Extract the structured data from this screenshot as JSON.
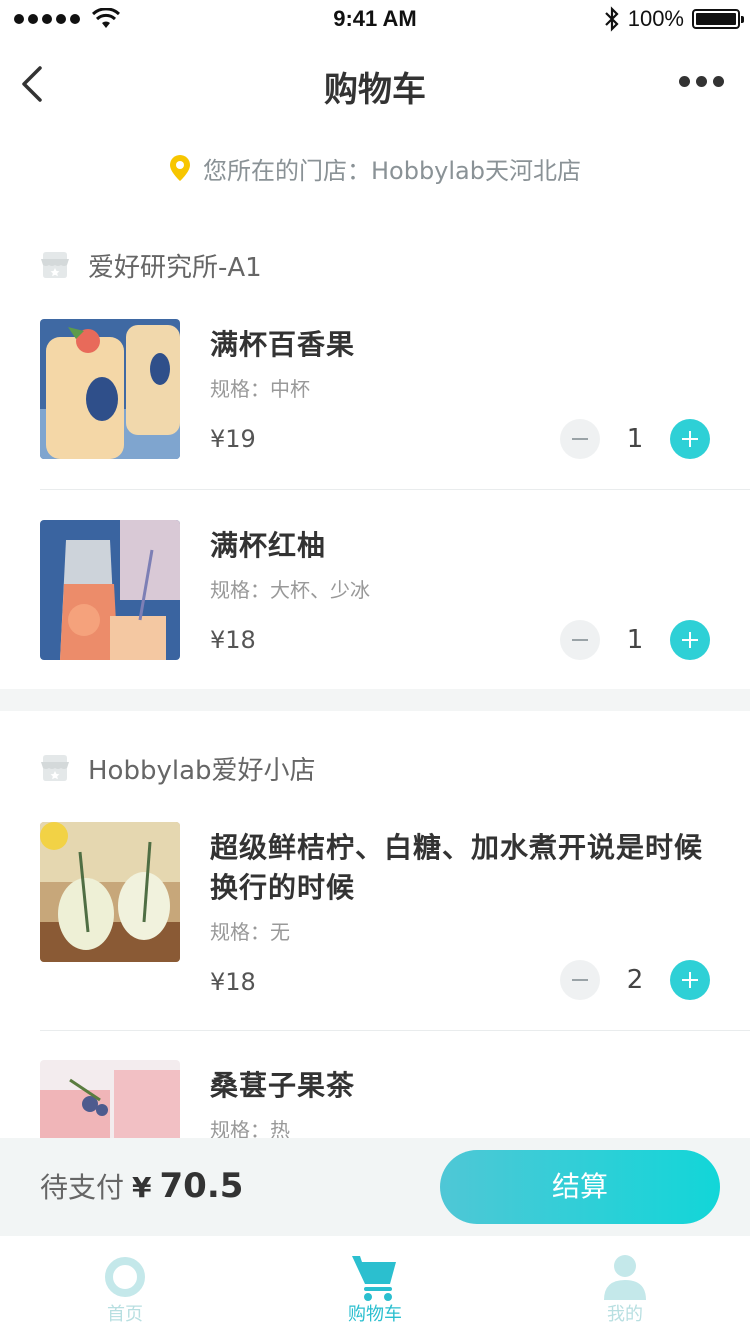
{
  "status_bar": {
    "time": "9:41 AM",
    "battery": "100%"
  },
  "nav": {
    "title": "购物车"
  },
  "location": {
    "text": "您所在的门店：Hobbylab天河北店"
  },
  "shops": [
    {
      "name": "爱好研究所-A1",
      "items": [
        {
          "name": "满杯百香果",
          "spec": "规格：中杯",
          "price": "¥19",
          "qty": "1"
        },
        {
          "name": "满杯红柚",
          "spec": "规格：大杯、少冰",
          "price": "¥18",
          "qty": "1"
        }
      ]
    },
    {
      "name": "Hobbylab爱好小店",
      "items": [
        {
          "name": "超级鲜桔柠、白糖、加水煮开说是时候换行的时候",
          "spec": "规格：无",
          "price": "¥18",
          "qty": "2"
        },
        {
          "name": "桑葚子果茶",
          "spec": "规格：热"
        }
      ]
    }
  ],
  "checkout": {
    "label": "待支付",
    "currency": "¥",
    "amount": "70.5",
    "button": "结算"
  },
  "tabs": [
    {
      "label": "首页"
    },
    {
      "label": "购物车"
    },
    {
      "label": "我的"
    }
  ],
  "colors": {
    "accent": "#2ed0d6",
    "location_pin": "#f7c600",
    "tab_active": "#2bbfcf"
  }
}
